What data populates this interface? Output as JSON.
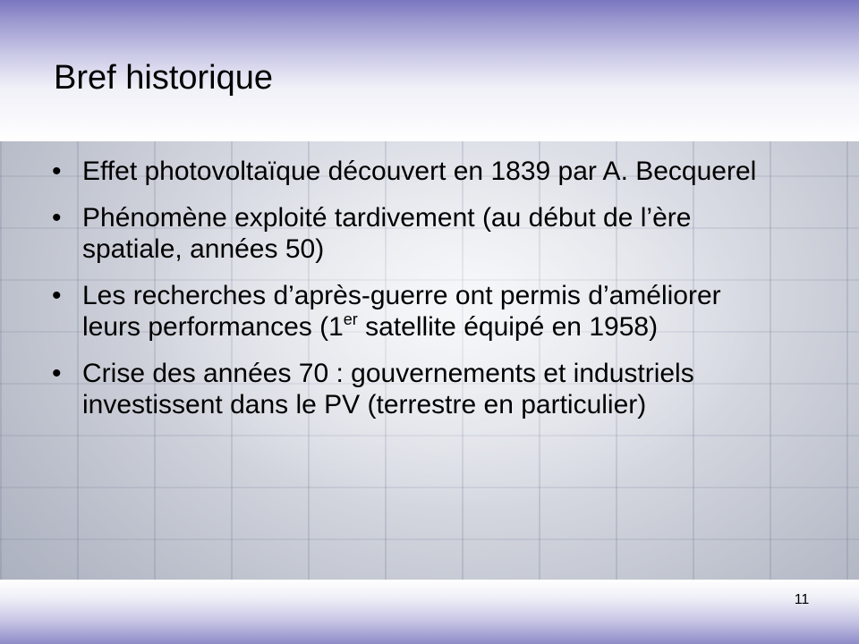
{
  "slide": {
    "title": "Bref historique",
    "page_number": "11",
    "bullet_glyph": "•",
    "bullets": [
      {
        "text": "Effet photovoltaïque découvert en 1839 par A. Becquerel"
      },
      {
        "text": "Phénomène exploité tardivement (au début de l’ère spatiale, années 50)"
      },
      {
        "text_before_sup": "Les recherches d’après-guerre ont permis d’améliorer leurs performances (1",
        "sup": "er",
        "text_after_sup": " satellite équipé en 1958)"
      },
      {
        "text": "Crise des années 70 : gouvernements et industriels investissent dans le PV (terrestre en particulier)"
      }
    ]
  }
}
